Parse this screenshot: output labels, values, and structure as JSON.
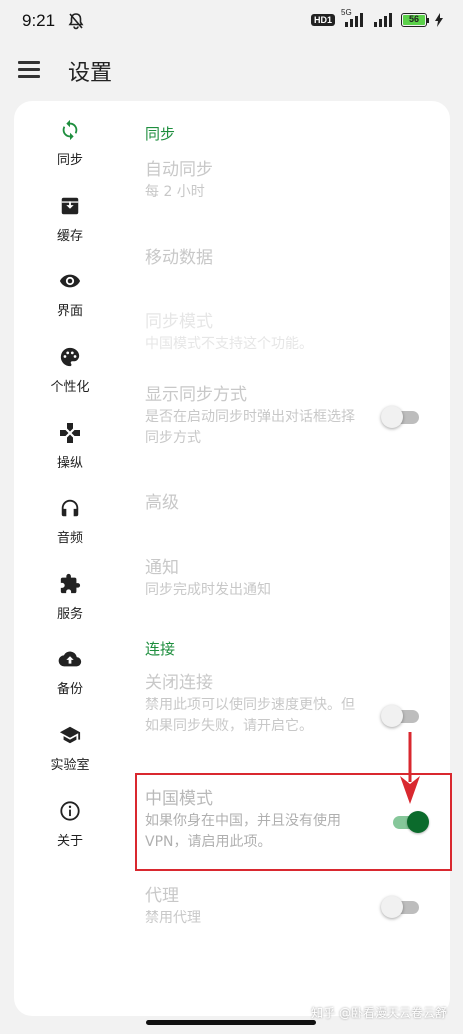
{
  "status": {
    "time": "9:21",
    "hd": "HD1",
    "net": "5G",
    "battery": "56"
  },
  "appbar": {
    "title": "设置",
    "menu_icon": "menu-icon"
  },
  "sidebar": {
    "items": [
      {
        "label": "同步",
        "icon": "sync-icon",
        "color": "#1e8e3e"
      },
      {
        "label": "缓存",
        "icon": "archive-icon"
      },
      {
        "label": "界面",
        "icon": "eye-icon"
      },
      {
        "label": "个性化",
        "icon": "palette-icon"
      },
      {
        "label": "操纵",
        "icon": "gamepad-icon"
      },
      {
        "label": "音频",
        "icon": "headphones-icon"
      },
      {
        "label": "服务",
        "icon": "puzzle-icon"
      },
      {
        "label": "备份",
        "icon": "cloud-upload-icon"
      },
      {
        "label": "实验室",
        "icon": "school-icon"
      },
      {
        "label": "关于",
        "icon": "info-icon"
      }
    ]
  },
  "sections": {
    "sync": {
      "header": "同步",
      "auto_sync": {
        "title": "自动同步",
        "summary": "每 2 小时"
      },
      "mobile_data": {
        "title": "移动数据"
      },
      "sync_mode": {
        "title": "同步模式",
        "summary": "中国模式不支持这个功能。"
      },
      "show_sync": {
        "title": "显示同步方式",
        "summary": "是否在启动同步时弹出对话框选择同步方式",
        "enabled": false
      },
      "advanced": {
        "title": "高级"
      },
      "notify": {
        "title": "通知",
        "summary": "同步完成时发出通知"
      }
    },
    "connection": {
      "header": "连接",
      "close_conn": {
        "title": "关闭连接",
        "summary": "禁用此项可以使同步速度更快。但如果同步失败，请开启它。",
        "enabled": false
      },
      "china_mode": {
        "title": "中国模式",
        "summary": "如果你身在中国，并且没有使用 VPN，请启用此项。",
        "enabled": true
      },
      "proxy": {
        "title": "代理",
        "summary": "禁用代理",
        "enabled": false
      }
    }
  },
  "annotation": {
    "color": "#d9282f"
  },
  "watermark": "知乎 @卧看漫天云卷云舒"
}
